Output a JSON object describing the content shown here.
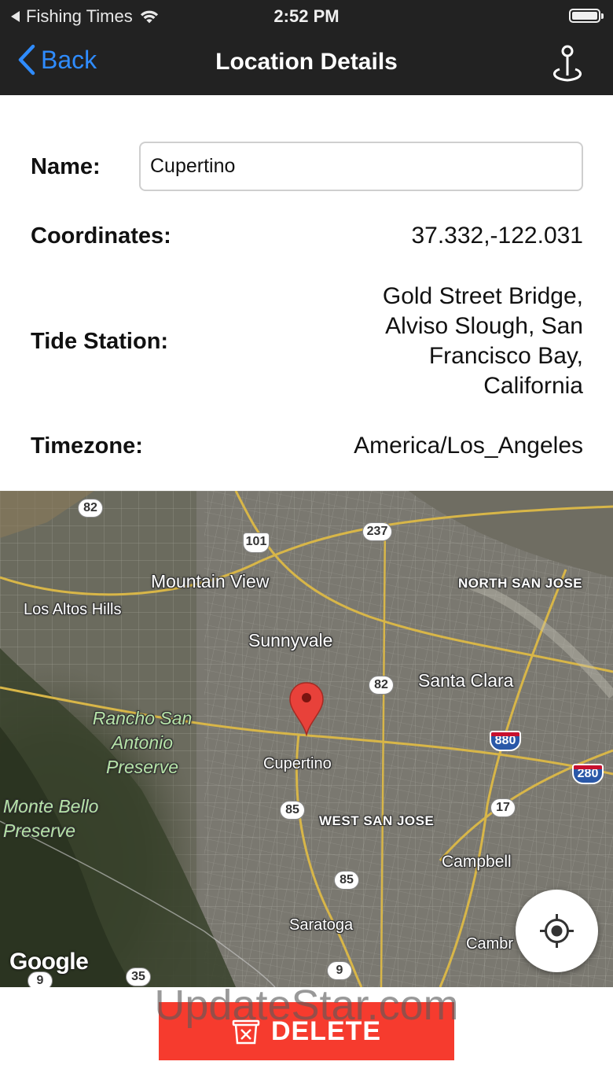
{
  "status_bar": {
    "app_back": "Fishing Times",
    "time": "2:52 PM"
  },
  "nav": {
    "back_label": "Back",
    "title": "Location Details",
    "action_icon": "location-pin-icon"
  },
  "form": {
    "name_label": "Name:",
    "name_value": "Cupertino",
    "coordinates_label": "Coordinates:",
    "coordinates_value": "37.332,-122.031",
    "tide_station_label": "Tide Station:",
    "tide_station_value": "Gold Street Bridge, Alviso Slough, San Francisco Bay, California",
    "timezone_label": "Timezone:",
    "timezone_value": "America/Los_Angeles"
  },
  "map": {
    "labels": {
      "mountain_view": "Mountain View",
      "los_altos_hills": "Los Altos Hills",
      "sunnyvale": "Sunnyvale",
      "north_san_jose": "NORTH SAN JOSE",
      "santa_clara": "Santa Clara",
      "rancho_san_antonio": "Rancho San Antonio Preserve",
      "cupertino": "Cupertino",
      "monte_bello": "Monte Bello Preserve",
      "west_san_jose": "WEST SAN JOSE",
      "campbell": "Campbell",
      "saratoga": "Saratoga",
      "cambrian": "Cambr"
    },
    "shields": {
      "r82a": "82",
      "r101": "101",
      "r237": "237",
      "r82b": "82",
      "i880": "880",
      "i280": "280",
      "r85a": "85",
      "r17": "17",
      "r85b": "85",
      "r9a": "9",
      "r35": "35",
      "r9b": "9"
    },
    "attribution": "Google",
    "locate_icon": "crosshair-icon"
  },
  "actions": {
    "delete_label": "DELETE",
    "delete_icon": "trash-icon"
  },
  "watermark": "UpdateStar.com",
  "colors": {
    "nav_bg": "#222222",
    "accent": "#2f8cff",
    "delete": "#f63b2e"
  }
}
